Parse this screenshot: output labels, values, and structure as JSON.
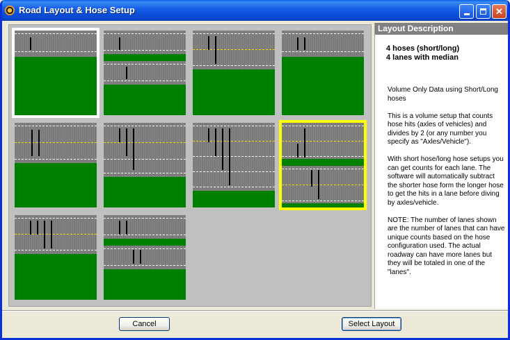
{
  "window": {
    "title": "Road Layout & Hose Setup"
  },
  "layout_panel": {
    "header": "Layout Description",
    "title_line1": "4 hoses (short/long)",
    "title_line2": "4 lanes with median",
    "paragraphs": [
      "Volume Only Data using Short/Long hoses",
      "This is a volume setup that counts hose hits (axles of vehicles) and divides by 2 (or any number you specify as \"Axles/Vehicle\").",
      "With short hose/long hose setups you can get counts for each lane.  The software will automatically subtract the shorter hose form the longer hose to get the hits in a lane before diving by axles/vehicle.",
      "NOTE: The number of lanes shown are the number of lanes that can have unique counts based on the hose configuration used.  The actual roadway can have more lanes but they will be totaled in one of the \"lanes\"."
    ]
  },
  "layouts": {
    "count": 10,
    "selected_index": 7,
    "highlighted_first_index": 0
  },
  "buttons": {
    "cancel": "Cancel",
    "select": "Select Layout"
  },
  "colors": {
    "grass": "#008000",
    "road": "#7f7f7f",
    "hose": "#000000",
    "selected_outline": "#ffff00",
    "first_outline": "#ffffff",
    "titlebar": "#0b4ed8"
  }
}
